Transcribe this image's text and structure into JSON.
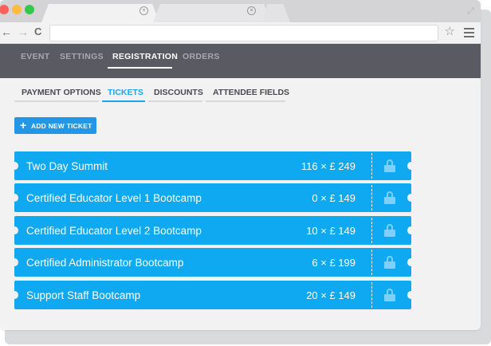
{
  "browser": {
    "tab_close_glyph": "×",
    "nav": {
      "back": "←",
      "forward": "→",
      "reload": "C"
    },
    "star_glyph": "☆",
    "expand_glyph": "⤢"
  },
  "main_tabs": [
    {
      "label": "EVENT",
      "active": false
    },
    {
      "label": "SETTINGS",
      "active": false
    },
    {
      "label": "REGISTRATION",
      "active": true
    },
    {
      "label": "ORDERS",
      "active": false
    }
  ],
  "sub_tabs": [
    {
      "label": "PAYMENT OPTIONS",
      "active": false
    },
    {
      "label": "TICKETS",
      "active": true
    },
    {
      "label": "DISCOUNTS",
      "active": false
    },
    {
      "label": "ATTENDEE FIELDS",
      "active": false
    }
  ],
  "add_button": {
    "icon": "+",
    "label": "ADD NEW TICKET"
  },
  "tickets": [
    {
      "name": "Two Day Summit",
      "quantity": "116 × £ 249",
      "icon": "lock-icon"
    },
    {
      "name": "Certified Educator Level 1 Bootcamp",
      "quantity": "0 × £ 149",
      "icon": "lock-icon"
    },
    {
      "name": "Certified Educator Level 2 Bootcamp",
      "quantity": "10 × £ 149",
      "icon": "lock-icon"
    },
    {
      "name": "Certified Administrator Bootcamp",
      "quantity": "6 × £ 199",
      "icon": "lock-icon"
    },
    {
      "name": "Support Staff Bootcamp",
      "quantity": "20 × £ 149",
      "icon": "lock-icon"
    }
  ],
  "colors": {
    "header_bg": "#5a5a63",
    "accent": "#1aa5ee",
    "ticket_bg": "#0ea9f0",
    "button_bg": "#2496e6"
  }
}
